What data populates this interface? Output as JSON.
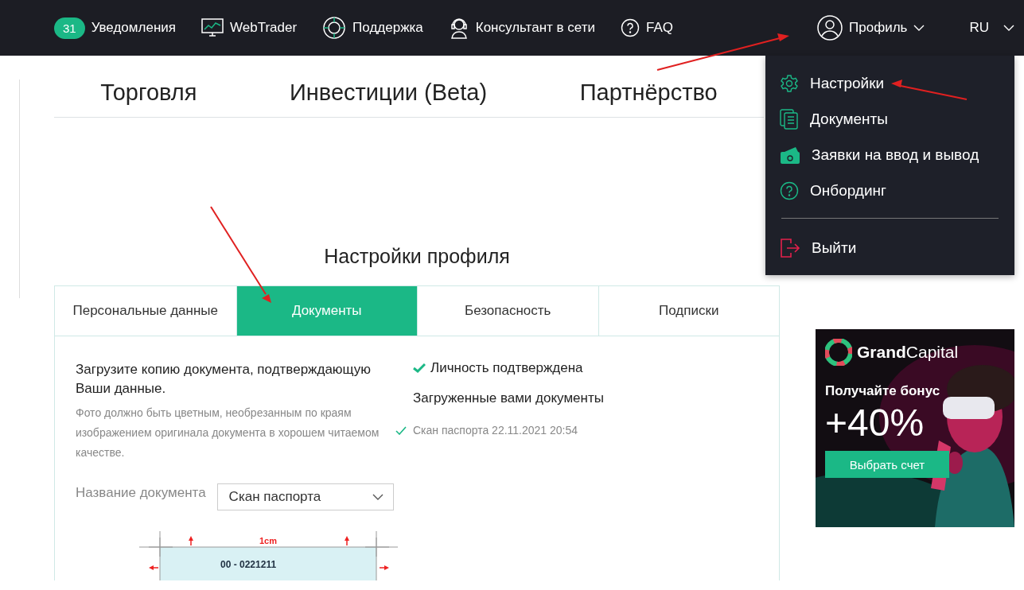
{
  "header": {
    "notifications": {
      "count": "31",
      "label": "Уведомления"
    },
    "nav": [
      {
        "kind": "monitor",
        "label": "WebTrader"
      },
      {
        "kind": "target",
        "label": "Поддержка"
      },
      {
        "kind": "headset",
        "label": "Консультант в сети"
      },
      {
        "kind": "help",
        "label": "FAQ"
      }
    ],
    "profile": "Профиль",
    "language": "RU"
  },
  "top_tabs": [
    {
      "label": "Торговля",
      "selected": false
    },
    {
      "label": "Инвестиции (Beta)",
      "selected": false
    },
    {
      "label": "Партнёрство",
      "selected": false
    }
  ],
  "settings": {
    "title": "Настройки профиля",
    "tabs": [
      {
        "label": "Персональные данные",
        "selected": false
      },
      {
        "label": "Документы",
        "selected": true
      },
      {
        "label": "Безопасность",
        "selected": false
      },
      {
        "label": "Подписки",
        "selected": false
      }
    ],
    "instruction": "Загрузите копию документа, подтверждающую Ваши данные.",
    "hint": "Фото должно быть цветным, необрезанным по краям изображением оригинала документа в хорошем читаемом качестве.",
    "identity_status": "Личность подтверждена",
    "uploaded_heading": "Загруженные вами документы",
    "uploaded": [
      {
        "label": "Скан паспорта 22.11.2021 20:54"
      }
    ],
    "document_name_label": "Название документа",
    "document_name_value": "Скан паспорта",
    "sample": {
      "margin_label": "1cm",
      "number": "00 - 0221211"
    }
  },
  "profile_menu": {
    "items": [
      {
        "kind": "gear",
        "label": "Настройки"
      },
      {
        "kind": "docs",
        "label": "Документы"
      },
      {
        "kind": "wallet",
        "label": "Заявки на ввод и вывод"
      },
      {
        "kind": "help",
        "label": "Онбординг"
      },
      {
        "kind": "logout",
        "label": "Выйти"
      }
    ]
  },
  "banner": {
    "brand": "**Grand**Capital",
    "headline": "Получайте бонус",
    "bonus": "+40%",
    "button": "Выбрать счет"
  }
}
